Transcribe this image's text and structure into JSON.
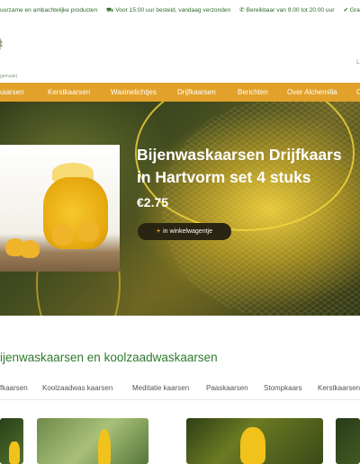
{
  "topbar": {
    "items": [
      "uurzame en ambachtelijke producten",
      "⛟ Voor 15:00 uur besteld, vandaag verzonden",
      "✆ Bereikbaar van 9.00 tot 20.00 uur",
      "✔ Gratis verzen"
    ]
  },
  "header": {
    "tagline": "gemaakt",
    "language_label": "L"
  },
  "nav": {
    "items": [
      "kaarsen",
      "Kerstkaarsen",
      "Waxinelichtjes",
      "Drijfkaarsen",
      "Berichten",
      "Over Alchemilla",
      "C"
    ]
  },
  "hero": {
    "title_line1": "Bijenwaskaarsen Drijfkaars",
    "title_line2": "in Hartvorm set 4 stuks",
    "price": "€2.75",
    "cart_button_prefix": "+",
    "cart_button_label": "in winkelwagentje"
  },
  "products_section": {
    "title": "ijenwaskaarsen en koolzaadwaskaarsen",
    "categories": [
      "fkaarsen",
      "Koolzaadwas kaarsen",
      "Meditatie kaarsen",
      "Paaskaarsen",
      "Stompkaars",
      "Kerstkaarsen"
    ]
  },
  "colors": {
    "nav_background": "#e2a12a",
    "topbar_text": "#2e6b2a",
    "section_title": "#2e7a2e",
    "cart_button_background": "#2a2512"
  }
}
